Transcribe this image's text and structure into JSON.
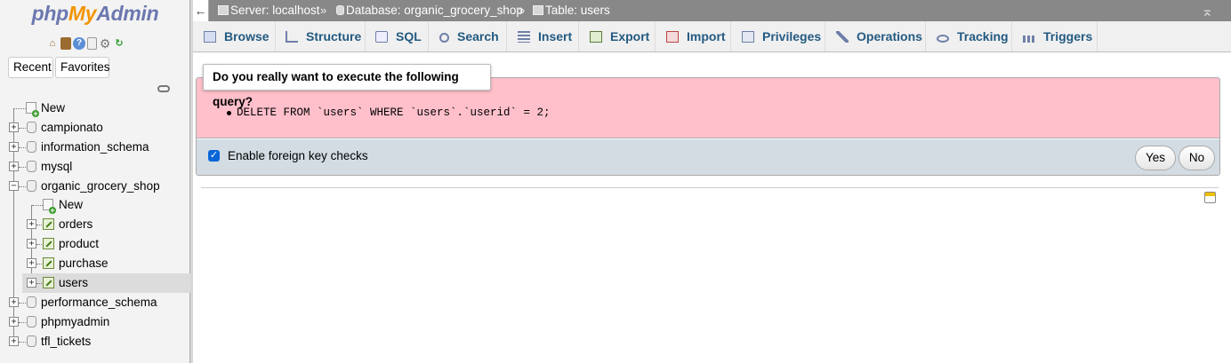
{
  "logo": {
    "php": "php",
    "my": "My",
    "admin": "Admin"
  },
  "nav": {
    "icons": [
      "home-icon",
      "logout-icon",
      "help-icon",
      "docs-icon",
      "settings-icon",
      "reload-icon"
    ],
    "tabs": {
      "recent": "Recent",
      "favorites": "Favorites"
    },
    "tree": {
      "new": "New",
      "databases": [
        {
          "name": "campionato"
        },
        {
          "name": "information_schema"
        },
        {
          "name": "mysql"
        },
        {
          "name": "organic_grocery_shop",
          "expanded": true,
          "children": {
            "new": "New",
            "tables": [
              "orders",
              "product",
              "purchase",
              "users"
            ],
            "selected": "users"
          }
        },
        {
          "name": "performance_schema"
        },
        {
          "name": "phpmyadmin"
        },
        {
          "name": "tfl_tickets"
        }
      ]
    }
  },
  "breadcrumb": {
    "server": "Server: localhost",
    "database": "Database: organic_grocery_shop",
    "table": "Table: users",
    "separator": "»"
  },
  "tabs": [
    "Browse",
    "Structure",
    "SQL",
    "Search",
    "Insert",
    "Export",
    "Import",
    "Privileges",
    "Operations",
    "Tracking",
    "Triggers"
  ],
  "dialog": {
    "title": "Do you really want to execute the following query?",
    "query": "DELETE FROM `users` WHERE `users`.`userid` = 2;",
    "fk_label": "Enable foreign key checks",
    "fk_checked": true,
    "yes": "Yes",
    "no": "No"
  },
  "colors": {
    "query_bg": "#ffc0cb",
    "fk_bg": "#d3dce3",
    "tab_text": "#235a81",
    "topbar": "#888888"
  }
}
